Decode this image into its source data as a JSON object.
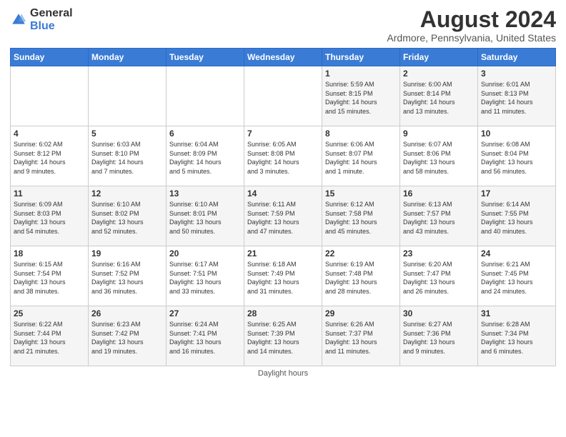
{
  "logo": {
    "general": "General",
    "blue": "Blue"
  },
  "title": "August 2024",
  "location": "Ardmore, Pennsylvania, United States",
  "days_of_week": [
    "Sunday",
    "Monday",
    "Tuesday",
    "Wednesday",
    "Thursday",
    "Friday",
    "Saturday"
  ],
  "footer": "Daylight hours",
  "weeks": [
    [
      {
        "day": "",
        "info": ""
      },
      {
        "day": "",
        "info": ""
      },
      {
        "day": "",
        "info": ""
      },
      {
        "day": "",
        "info": ""
      },
      {
        "day": "1",
        "info": "Sunrise: 5:59 AM\nSunset: 8:15 PM\nDaylight: 14 hours\nand 15 minutes."
      },
      {
        "day": "2",
        "info": "Sunrise: 6:00 AM\nSunset: 8:14 PM\nDaylight: 14 hours\nand 13 minutes."
      },
      {
        "day": "3",
        "info": "Sunrise: 6:01 AM\nSunset: 8:13 PM\nDaylight: 14 hours\nand 11 minutes."
      }
    ],
    [
      {
        "day": "4",
        "info": "Sunrise: 6:02 AM\nSunset: 8:12 PM\nDaylight: 14 hours\nand 9 minutes."
      },
      {
        "day": "5",
        "info": "Sunrise: 6:03 AM\nSunset: 8:10 PM\nDaylight: 14 hours\nand 7 minutes."
      },
      {
        "day": "6",
        "info": "Sunrise: 6:04 AM\nSunset: 8:09 PM\nDaylight: 14 hours\nand 5 minutes."
      },
      {
        "day": "7",
        "info": "Sunrise: 6:05 AM\nSunset: 8:08 PM\nDaylight: 14 hours\nand 3 minutes."
      },
      {
        "day": "8",
        "info": "Sunrise: 6:06 AM\nSunset: 8:07 PM\nDaylight: 14 hours\nand 1 minute."
      },
      {
        "day": "9",
        "info": "Sunrise: 6:07 AM\nSunset: 8:06 PM\nDaylight: 13 hours\nand 58 minutes."
      },
      {
        "day": "10",
        "info": "Sunrise: 6:08 AM\nSunset: 8:04 PM\nDaylight: 13 hours\nand 56 minutes."
      }
    ],
    [
      {
        "day": "11",
        "info": "Sunrise: 6:09 AM\nSunset: 8:03 PM\nDaylight: 13 hours\nand 54 minutes."
      },
      {
        "day": "12",
        "info": "Sunrise: 6:10 AM\nSunset: 8:02 PM\nDaylight: 13 hours\nand 52 minutes."
      },
      {
        "day": "13",
        "info": "Sunrise: 6:10 AM\nSunset: 8:01 PM\nDaylight: 13 hours\nand 50 minutes."
      },
      {
        "day": "14",
        "info": "Sunrise: 6:11 AM\nSunset: 7:59 PM\nDaylight: 13 hours\nand 47 minutes."
      },
      {
        "day": "15",
        "info": "Sunrise: 6:12 AM\nSunset: 7:58 PM\nDaylight: 13 hours\nand 45 minutes."
      },
      {
        "day": "16",
        "info": "Sunrise: 6:13 AM\nSunset: 7:57 PM\nDaylight: 13 hours\nand 43 minutes."
      },
      {
        "day": "17",
        "info": "Sunrise: 6:14 AM\nSunset: 7:55 PM\nDaylight: 13 hours\nand 40 minutes."
      }
    ],
    [
      {
        "day": "18",
        "info": "Sunrise: 6:15 AM\nSunset: 7:54 PM\nDaylight: 13 hours\nand 38 minutes."
      },
      {
        "day": "19",
        "info": "Sunrise: 6:16 AM\nSunset: 7:52 PM\nDaylight: 13 hours\nand 36 minutes."
      },
      {
        "day": "20",
        "info": "Sunrise: 6:17 AM\nSunset: 7:51 PM\nDaylight: 13 hours\nand 33 minutes."
      },
      {
        "day": "21",
        "info": "Sunrise: 6:18 AM\nSunset: 7:49 PM\nDaylight: 13 hours\nand 31 minutes."
      },
      {
        "day": "22",
        "info": "Sunrise: 6:19 AM\nSunset: 7:48 PM\nDaylight: 13 hours\nand 28 minutes."
      },
      {
        "day": "23",
        "info": "Sunrise: 6:20 AM\nSunset: 7:47 PM\nDaylight: 13 hours\nand 26 minutes."
      },
      {
        "day": "24",
        "info": "Sunrise: 6:21 AM\nSunset: 7:45 PM\nDaylight: 13 hours\nand 24 minutes."
      }
    ],
    [
      {
        "day": "25",
        "info": "Sunrise: 6:22 AM\nSunset: 7:44 PM\nDaylight: 13 hours\nand 21 minutes."
      },
      {
        "day": "26",
        "info": "Sunrise: 6:23 AM\nSunset: 7:42 PM\nDaylight: 13 hours\nand 19 minutes."
      },
      {
        "day": "27",
        "info": "Sunrise: 6:24 AM\nSunset: 7:41 PM\nDaylight: 13 hours\nand 16 minutes."
      },
      {
        "day": "28",
        "info": "Sunrise: 6:25 AM\nSunset: 7:39 PM\nDaylight: 13 hours\nand 14 minutes."
      },
      {
        "day": "29",
        "info": "Sunrise: 6:26 AM\nSunset: 7:37 PM\nDaylight: 13 hours\nand 11 minutes."
      },
      {
        "day": "30",
        "info": "Sunrise: 6:27 AM\nSunset: 7:36 PM\nDaylight: 13 hours\nand 9 minutes."
      },
      {
        "day": "31",
        "info": "Sunrise: 6:28 AM\nSunset: 7:34 PM\nDaylight: 13 hours\nand 6 minutes."
      }
    ]
  ]
}
